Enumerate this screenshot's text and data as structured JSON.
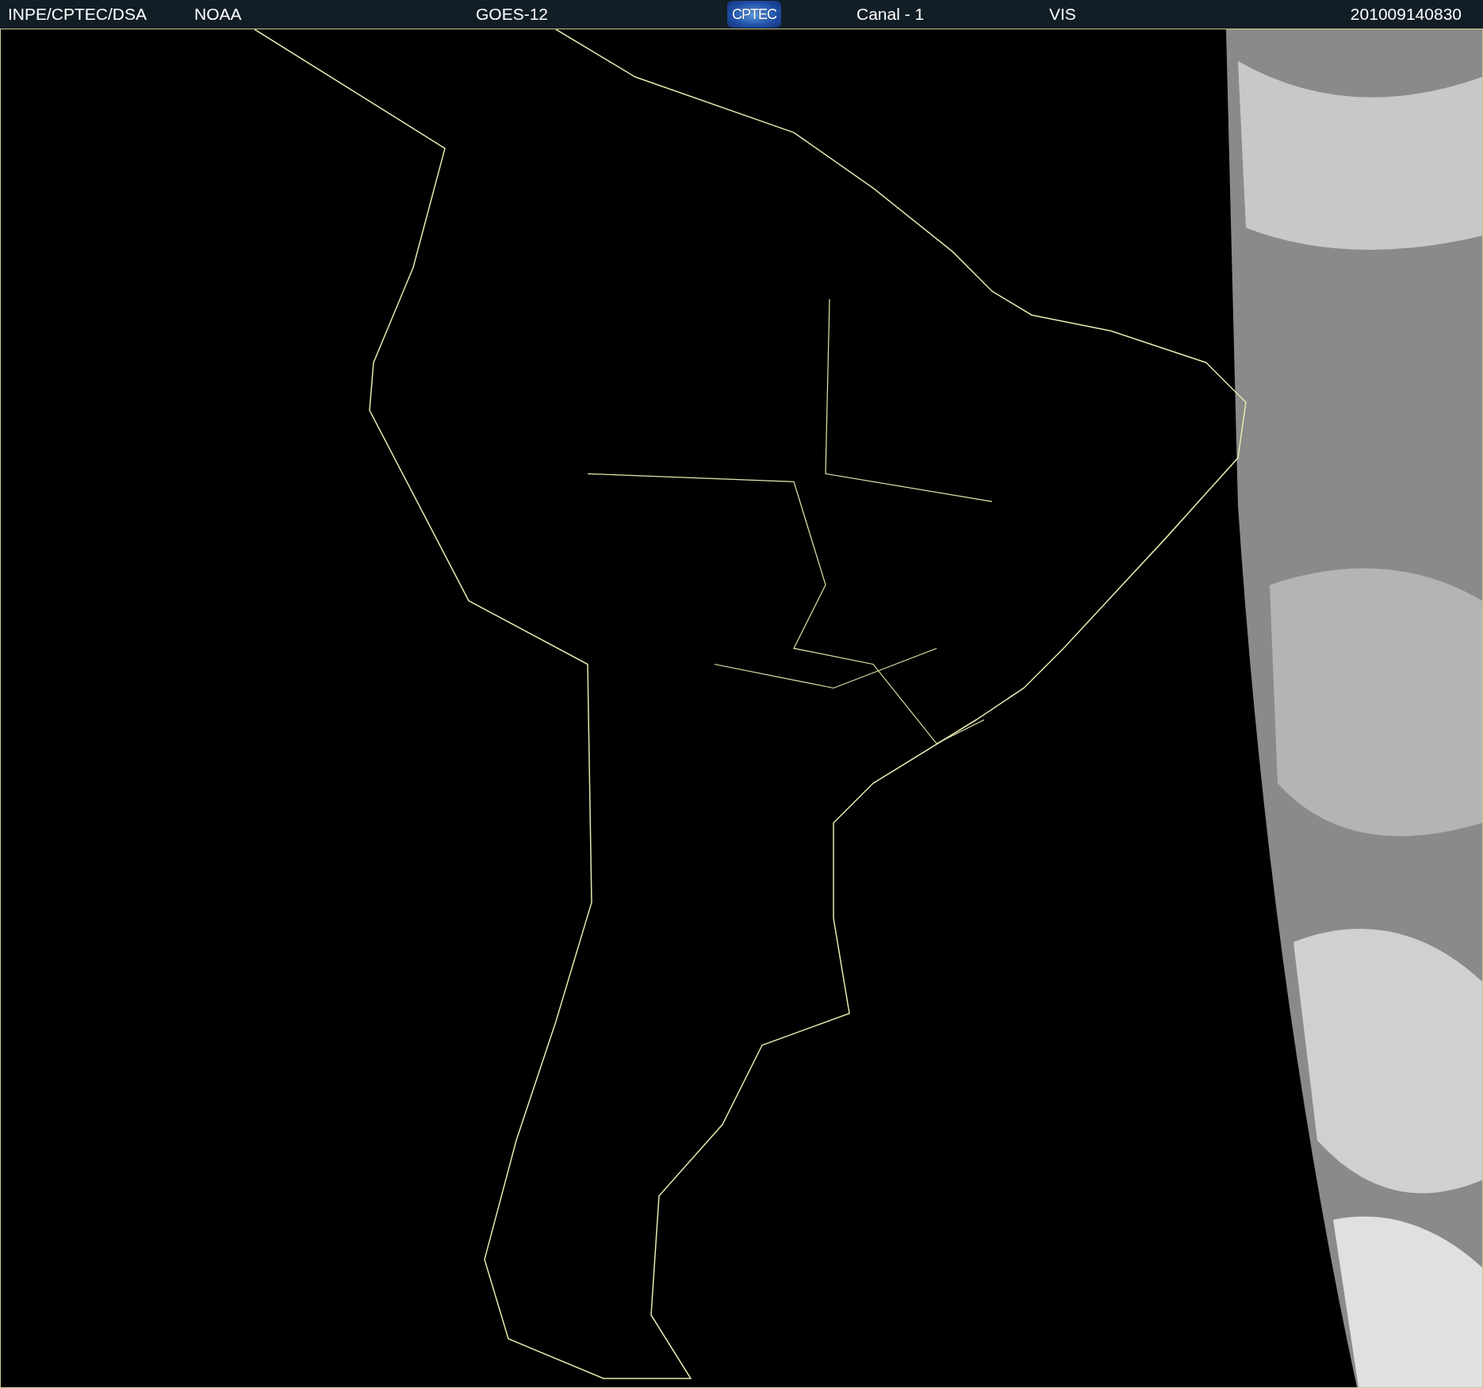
{
  "header": {
    "items": [
      {
        "kind": "text",
        "label": "INPE/CPTEC/DSA"
      },
      {
        "kind": "text",
        "label": "NOAA"
      },
      {
        "kind": "text",
        "label": "GOES-12"
      },
      {
        "kind": "logo",
        "label": "CPTEC"
      },
      {
        "kind": "text",
        "label": "Canal - 1"
      },
      {
        "kind": "text",
        "label": "VIS"
      },
      {
        "kind": "text",
        "label": "201009140830"
      }
    ]
  }
}
